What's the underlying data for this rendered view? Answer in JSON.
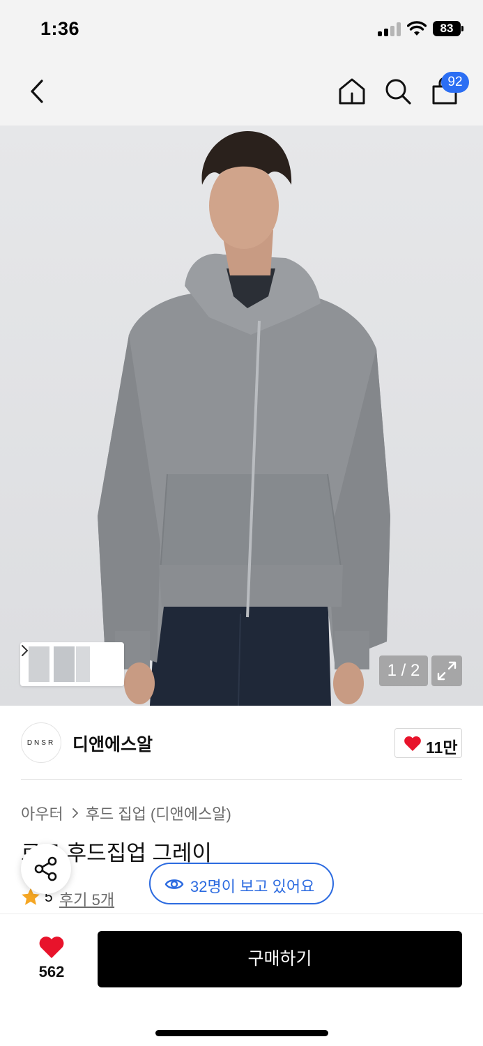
{
  "status_bar": {
    "time": "1:36",
    "battery": "83"
  },
  "nav": {
    "cart_badge": "92"
  },
  "gallery": {
    "page_indicator": "1 / 2"
  },
  "brand": {
    "logo_text": "DNSR",
    "name": "디앤에스알",
    "like_count": "11만"
  },
  "product": {
    "breadcrumb": [
      "아우터",
      "후드 집업 (디앤에스알)"
    ],
    "title": "로고 후드집업 그레이",
    "rating": "5",
    "review_link": "후기 5개"
  },
  "viewers": {
    "text": "32명이 보고 있어요"
  },
  "bottom_bar": {
    "wish_count": "562",
    "buy_label": "구매하기"
  },
  "colors": {
    "accent_blue": "#2c6be0",
    "badge_blue": "#2b6ef3",
    "heart_red": "#e8132b",
    "star_orange": "#f5a623"
  }
}
